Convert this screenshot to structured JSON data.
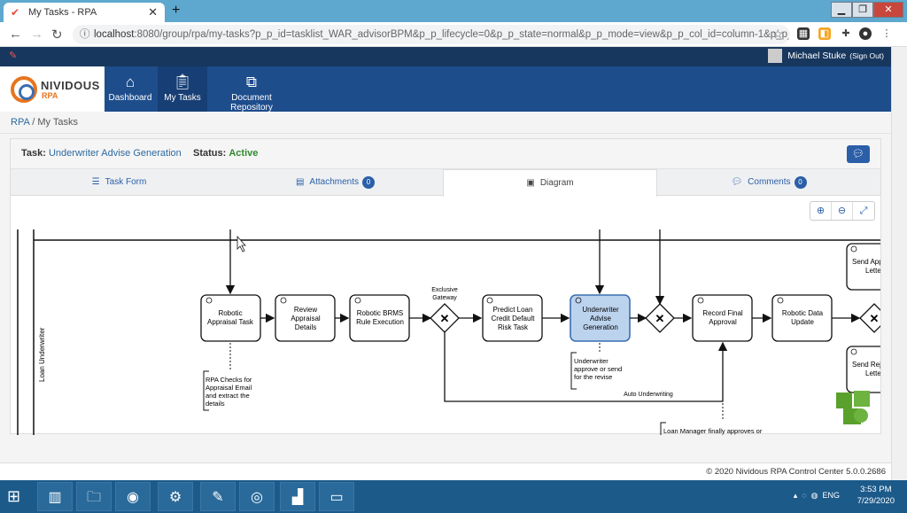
{
  "browser": {
    "tab_title": "My Tasks - RPA",
    "url_host": "localhost",
    "url_rest": ":8080/group/rpa/my-tasks?p_p_id=tasklist_WAR_advisorBPM&p_p_lifecycle=0&p_p_state=normal&p_p_mode=view&p_p_col_id=column-1&p_p_col_pos..."
  },
  "user": {
    "name": "Michael Stuke",
    "sign_out": "(Sign Out)"
  },
  "logo": {
    "name": "NIVIDOUS",
    "sub": "RPA"
  },
  "nav": {
    "items": [
      {
        "label": "Dashboard",
        "icon": "home-icon"
      },
      {
        "label": "My Tasks",
        "icon": "clipboard-icon"
      },
      {
        "label": "Document Repository",
        "icon": "network-icon"
      }
    ]
  },
  "breadcrumb": {
    "root": "RPA",
    "sep": "/",
    "current": "My Tasks"
  },
  "task": {
    "label": "Task:",
    "name": "Underwriter Advise Generation",
    "status_label": "Status:",
    "status": "Active"
  },
  "tabs": [
    {
      "label": "Task Form",
      "badge": ""
    },
    {
      "label": "Attachments",
      "badge": "0"
    },
    {
      "label": "Diagram",
      "badge": ""
    },
    {
      "label": "Comments",
      "badge": "0"
    }
  ],
  "diagram": {
    "lane": "Loan Underwriter",
    "tasks": [
      "Robotic Appraisal Task",
      "Review Appraisal Details",
      "Robotic BRMS Rule Execution",
      "Predict Loan Credit Default Risk Task",
      "Underwriter Advise Generation",
      "Record Final Approval",
      "Robotic Data Update"
    ],
    "gateway_label": "Exclusive Gateway",
    "edge_label": "Auto Underwriting",
    "notes": [
      "RPA Checks for Appraisal Email and extract the details",
      "Underwriter approve or send for the revise",
      "Loan Manager finally approves or"
    ],
    "right_tasks": [
      "Send App Lette",
      "Send Rej Lette"
    ]
  },
  "footer": "© 2020 Nividous RPA Control Center 5.0.0.2686",
  "taskbar": {
    "time": "3:53 PM",
    "date": "7/29/2020",
    "lang": "ENG"
  },
  "colors": {
    "nav": "#1e4d8c",
    "top": "#17375e",
    "accent": "#2b5fa8",
    "active_task": "#bcd3ee"
  }
}
